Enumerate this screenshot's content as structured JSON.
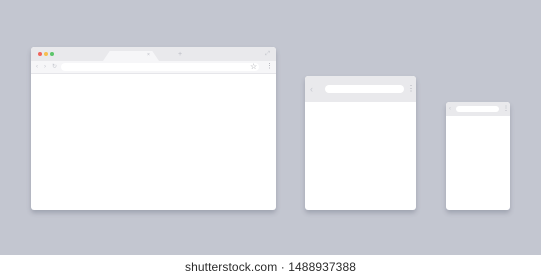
{
  "desktop_window": {
    "traffic_lights": {
      "close_color": "#f0655d",
      "minimize_color": "#f6be4f",
      "maximize_color": "#5dc56b"
    },
    "tab": {
      "close_glyph": "×"
    },
    "new_tab_glyph": "+",
    "resize_glyph": "⤢",
    "nav": {
      "back": "‹",
      "forward": "›",
      "reload": "↻"
    },
    "address_bar_value": "",
    "bookmark_glyph": "☆",
    "menu_glyph": "⋮"
  },
  "tablet_window": {
    "back_glyph": "‹",
    "address_bar_value": "",
    "menu_glyph": "⋮"
  },
  "phone_window": {
    "back_glyph": "‹",
    "address_bar_value": "",
    "menu_glyph": "⋮"
  },
  "watermark": {
    "text": "shutterstock.com · 1488937388"
  },
  "colors": {
    "background": "#c3c6d0",
    "window_body": "#ffffff",
    "chrome_bar": "#e9e9ec"
  }
}
